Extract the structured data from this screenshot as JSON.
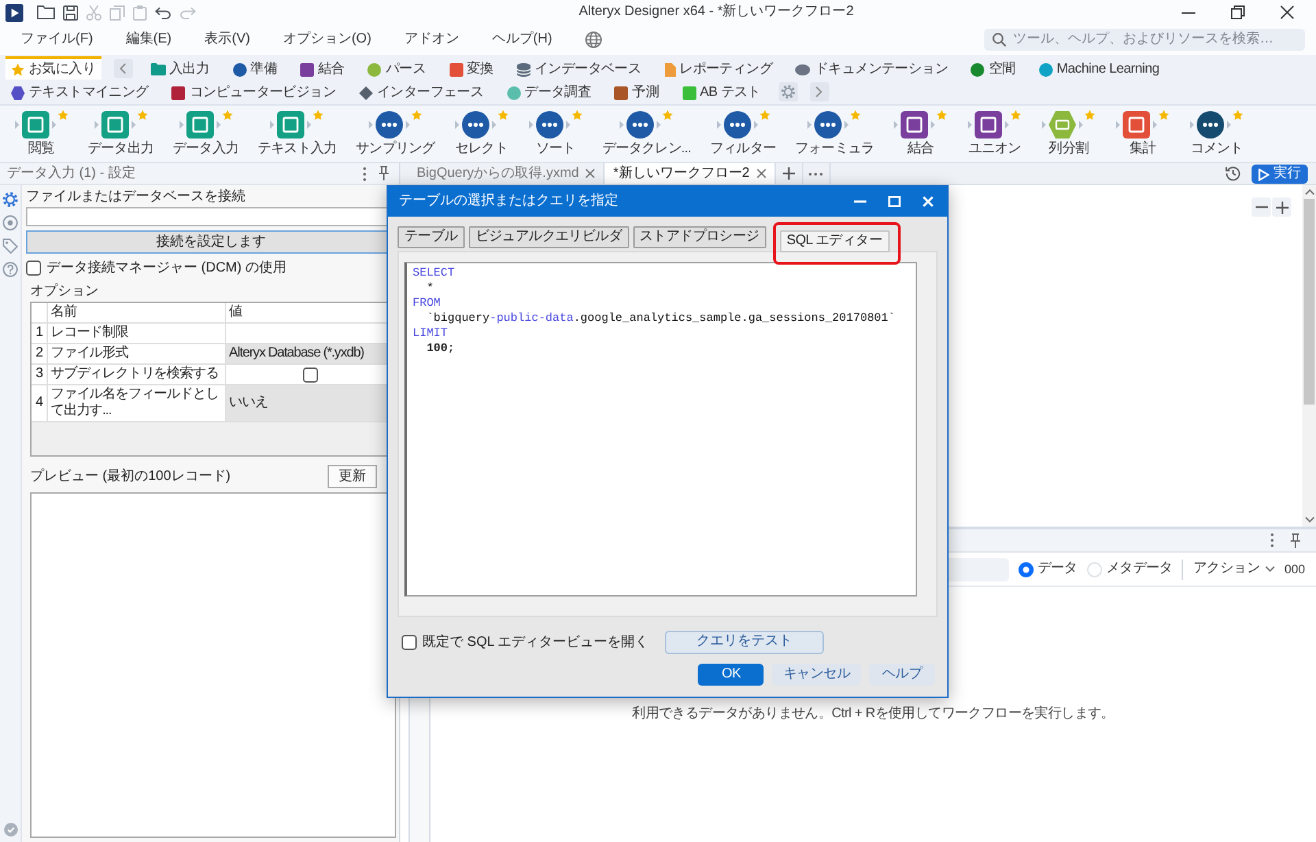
{
  "title_bar": {
    "title": "Alteryx Designer x64 - *新しいワークフロー2",
    "quick_access": [
      {
        "kind": "open",
        "disabled": false
      },
      {
        "kind": "save",
        "disabled": false
      },
      {
        "kind": "cut",
        "disabled": true
      },
      {
        "kind": "copy",
        "disabled": true
      },
      {
        "kind": "paste",
        "disabled": true
      },
      {
        "kind": "undo",
        "disabled": false
      },
      {
        "kind": "redo",
        "disabled": true
      }
    ]
  },
  "menu": {
    "items": [
      "ファイル(F)",
      "編集(E)",
      "表示(V)",
      "オプション(O)",
      "アドオン",
      "ヘルプ(H)"
    ],
    "search": {
      "placeholder": "ツール、ヘルプ、およびリソースを検索…"
    }
  },
  "categories": [
    {
      "label": "お気に入り",
      "kind": "star",
      "color": "#f2b200",
      "selected": true
    },
    {
      "label": "入出力",
      "kind": "folder",
      "color": "#11998a",
      "selected": false
    },
    {
      "label": "準備",
      "kind": "circle",
      "color": "#1f5aa6",
      "selected": false
    },
    {
      "label": "結合",
      "kind": "square",
      "color": "#7a3f9d",
      "selected": false
    },
    {
      "label": "パース",
      "kind": "circle",
      "color": "#8cb83e",
      "selected": false
    },
    {
      "label": "変換",
      "kind": "square",
      "color": "#e2503a",
      "selected": false
    },
    {
      "label": "インデータベース",
      "kind": "database",
      "color": "#5b6b7d",
      "selected": false
    },
    {
      "label": "レポーティング",
      "kind": "document",
      "color": "#ee9b3b",
      "selected": false
    },
    {
      "label": "ドキュメンテーション",
      "kind": "ellipse",
      "color": "#6b7384",
      "selected": false
    },
    {
      "label": "空間",
      "kind": "circle",
      "color": "#18892f",
      "selected": false
    },
    {
      "label": "Machine Learning",
      "kind": "circle",
      "color": "#10a3c6",
      "selected": false
    },
    {
      "label": "テキストマイニング",
      "kind": "hexagon",
      "color": "#5650c6",
      "selected": false
    },
    {
      "label": "コンピュータービジョン",
      "kind": "square",
      "color": "#b0223a",
      "selected": false
    },
    {
      "label": "インターフェース",
      "kind": "diamond",
      "color": "#565f6c",
      "selected": false
    },
    {
      "label": "データ調査",
      "kind": "circle",
      "color": "#5bbeac",
      "selected": false
    },
    {
      "label": "予測",
      "kind": "square",
      "color": "#a95527",
      "selected": false
    },
    {
      "label": "AB テスト",
      "kind": "square",
      "color": "#3bbf3a",
      "selected": false
    }
  ],
  "tools": [
    {
      "label": "閲覧",
      "kind": "square",
      "color": "#13a085",
      "favorite": true
    },
    {
      "label": "データ出力",
      "kind": "square",
      "color": "#13a085",
      "favorite": true
    },
    {
      "label": "データ入力",
      "kind": "square",
      "color": "#13a085",
      "favorite": true
    },
    {
      "label": "テキスト入力",
      "kind": "square",
      "color": "#13a085",
      "favorite": true
    },
    {
      "label": "サンプリング",
      "kind": "circle",
      "color": "#1f5aa6",
      "favorite": true
    },
    {
      "label": "セレクト",
      "kind": "circle",
      "color": "#1f5aa6",
      "favorite": true
    },
    {
      "label": "ソート",
      "kind": "circle",
      "color": "#1f5aa6",
      "favorite": true
    },
    {
      "label": "データクレン...",
      "kind": "circle",
      "color": "#1f5aa6",
      "favorite": true
    },
    {
      "label": "フィルター",
      "kind": "circle",
      "color": "#1f5aa6",
      "favorite": true
    },
    {
      "label": "フォーミュラ",
      "kind": "circle",
      "color": "#1f5aa6",
      "favorite": true
    },
    {
      "label": "結合",
      "kind": "square",
      "color": "#7a3f9d",
      "favorite": true
    },
    {
      "label": "ユニオン",
      "kind": "square",
      "color": "#7a3f9d",
      "favorite": true
    },
    {
      "label": "列分割",
      "kind": "hexagon",
      "color": "#8cb83e",
      "favorite": true
    },
    {
      "label": "集計",
      "kind": "square",
      "color": "#e2503a",
      "favorite": true
    },
    {
      "label": "コメント",
      "kind": "circle",
      "color": "#154b6e",
      "favorite": true
    }
  ],
  "config_panel": {
    "title": "データ入力 (1) - 設定",
    "rail": [
      {
        "kind": "settings",
        "selected": true
      },
      {
        "kind": "target",
        "selected": false
      },
      {
        "kind": "tag",
        "selected": false
      },
      {
        "kind": "help",
        "selected": false
      }
    ],
    "connect_label": "ファイルまたはデータベースを接続",
    "connect_button": "接続を設定します",
    "dcm": {
      "label": "データ接続マネージャー (DCM) の使用",
      "checked": false
    },
    "options": {
      "title": "オプション",
      "columns": [
        "名前",
        "値"
      ],
      "rows": [
        {
          "number": "1",
          "name": "レコード制限",
          "kind": "text"
        },
        {
          "number": "2",
          "name": "ファイル形式",
          "kind": "select",
          "value": "Alteryx Database (*.yxdb)"
        },
        {
          "number": "3",
          "name": "サブディレクトリを検索する",
          "kind": "checkbox",
          "checked": false
        },
        {
          "number": "4",
          "name": "ファイル名をフィールドとして出力す...",
          "kind": "select",
          "value": "いいえ"
        }
      ]
    },
    "preview": {
      "title": "プレビュー (最初の100レコード)",
      "refresh_button": "更新"
    }
  },
  "workflow_tabs": [
    {
      "label": "BigQueryからの取得.yxmd",
      "selected": false
    },
    {
      "label": "*新しいワークフロー2",
      "selected": true
    }
  ],
  "run_button": "実行",
  "results": {
    "views": [
      {
        "label": "データ",
        "selected": true
      },
      {
        "label": "メタデータ",
        "selected": false
      }
    ],
    "action_menu": "アクション",
    "number_format": "000",
    "empty_message": "利用できるデータがありません。Ctrl + Rを使用してワークフローを実行します。"
  },
  "dialog": {
    "title": "テーブルの選択またはクエリを指定",
    "tabs": [
      {
        "label": "テーブル",
        "selected": false,
        "highlighted": false
      },
      {
        "label": "ビジュアルクエリビルダ",
        "selected": false,
        "highlighted": false
      },
      {
        "label": "ストアドプロシージ",
        "selected": false,
        "highlighted": false
      },
      {
        "label": "SQL エディター",
        "selected": true,
        "highlighted": true
      }
    ],
    "sql": [
      [
        {
          "text": "SELECT",
          "kind": "keyword"
        }
      ],
      [
        {
          "text": "  *",
          "kind": "plain"
        }
      ],
      [
        {
          "text": "FROM",
          "kind": "keyword"
        }
      ],
      [
        {
          "text": "  `bigquery",
          "kind": "plain"
        },
        {
          "text": "-public-data",
          "kind": "keyword"
        },
        {
          "text": ".google_analytics_sample.ga_sessions_20170801`",
          "kind": "plain"
        }
      ],
      [
        {
          "text": "LIMIT",
          "kind": "keyword"
        }
      ],
      [
        {
          "text": "  100",
          "kind": "number"
        },
        {
          "text": ";",
          "kind": "plain"
        }
      ]
    ],
    "default_view": {
      "label": "既定で SQL エディタービューを開く",
      "checked": false
    },
    "test_button": "クエリをテスト",
    "buttons": [
      {
        "label": "OK",
        "kind": "primary"
      },
      {
        "label": "キャンセル",
        "kind": "secondary"
      },
      {
        "label": "ヘルプ",
        "kind": "secondary"
      }
    ]
  }
}
